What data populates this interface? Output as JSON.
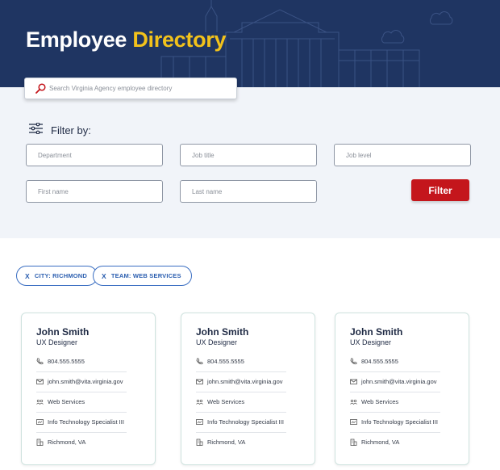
{
  "header": {
    "title_main": "Employee",
    "title_accent": "Directory"
  },
  "search": {
    "placeholder": "Search Virginia Agency employee directory"
  },
  "filters": {
    "heading": "Filter by:",
    "department_placeholder": "Department",
    "job_title_placeholder": "Job title",
    "job_level_placeholder": "Job level",
    "first_name_placeholder": "First name",
    "last_name_placeholder": "Last name",
    "button_label": "Filter"
  },
  "active_filters": [
    {
      "label": "CITY: RICHMOND"
    },
    {
      "label": "TEAM: WEB SERVICES"
    }
  ],
  "employees": [
    {
      "name": "John Smith",
      "job": "UX Designer",
      "phone": "804.555.5555",
      "email": "john.smith@vita.virginia.gov",
      "team": "Web Services",
      "level": "Info Technology Specialist III",
      "location": "Richmond, VA"
    },
    {
      "name": "John Smith",
      "job": "UX Designer",
      "phone": "804.555.5555",
      "email": "john.smith@vita.virginia.gov",
      "team": "Web Services",
      "level": "Info Technology Specialist III",
      "location": "Richmond, VA"
    },
    {
      "name": "John Smith",
      "job": "UX Designer",
      "phone": "804.555.5555",
      "email": "john.smith@vita.virginia.gov",
      "team": "Web Services",
      "level": "Info Technology Specialist III",
      "location": "Richmond, VA"
    }
  ],
  "colors": {
    "header_bg": "#1f3562",
    "accent_yellow": "#f2c21b",
    "filter_button": "#c4161c",
    "chip_blue": "#2c5fb0",
    "panel_bg": "#f1f4f9"
  },
  "icons": {
    "search": "search-icon",
    "filter": "sliders-icon",
    "phone": "phone-icon",
    "email": "envelope-icon",
    "team": "people-icon",
    "level": "id-card-icon",
    "location": "building-icon"
  }
}
